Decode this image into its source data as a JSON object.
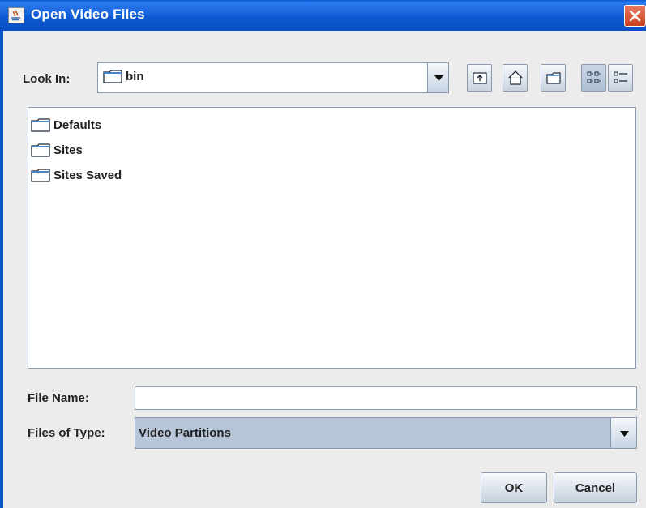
{
  "window": {
    "title": "Open Video Files"
  },
  "lookin": {
    "label": "Look In:",
    "mnemonic": "L",
    "value": "bin"
  },
  "toolbar": {
    "buttons": [
      {
        "name": "up-one-level",
        "icon": "folder-up-icon"
      },
      {
        "name": "home",
        "icon": "home-icon"
      },
      {
        "name": "new-folder",
        "icon": "new-folder-icon"
      },
      {
        "name": "list-view",
        "icon": "list-view-icon",
        "pressed": true
      },
      {
        "name": "details-view",
        "icon": "details-view-icon",
        "pressed": false
      }
    ]
  },
  "files": [
    {
      "name": "Defaults",
      "icon": "folder-icon"
    },
    {
      "name": "Sites",
      "icon": "folder-icon"
    },
    {
      "name": "Sites Saved",
      "icon": "folder-icon"
    }
  ],
  "filename": {
    "label": "File Name:",
    "mnemonic": "N",
    "value": ""
  },
  "filetype": {
    "label": "Files of Type:",
    "mnemonic": "T",
    "value": "Video Partitions"
  },
  "buttons": {
    "ok": "OK",
    "cancel": "Cancel"
  },
  "colors": {
    "titlebar": "#0b57d0",
    "selection": "#b6c5d8",
    "background": "#ececec"
  }
}
